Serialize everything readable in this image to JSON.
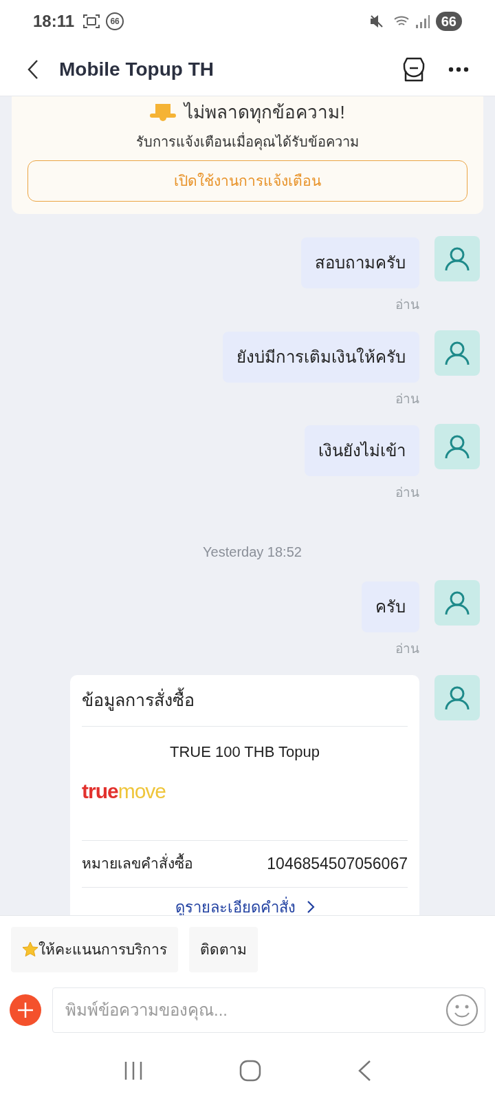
{
  "status_bar": {
    "time": "18:11",
    "notification_count": "66",
    "battery": "66"
  },
  "header": {
    "title": "Mobile Topup TH"
  },
  "banner": {
    "title": "ไม่พลาดทุกข้อความ!",
    "subtitle": "รับการแจ้งเตือนเมื่อคุณได้รับข้อความ",
    "button": "เปิดใช้งานการแจ้งเตือน"
  },
  "messages": [
    {
      "kind": "text",
      "text": "สอบถามครับ",
      "status": "อ่าน"
    },
    {
      "kind": "text",
      "text": "ยังบ่มีการเติมเงินให้ครับ",
      "status": "อ่าน"
    },
    {
      "kind": "text",
      "text": "เงินยังไม่เข้า",
      "status": "อ่าน"
    },
    {
      "kind": "timestamp",
      "text": "Yesterday 18:52"
    },
    {
      "kind": "text",
      "text": "ครับ",
      "status": "อ่าน"
    },
    {
      "kind": "order",
      "title": "ข้อมูลการสั่งซื้อ",
      "product": "TRUE 100 THB Topup",
      "logo": [
        "true",
        "move"
      ],
      "order_label": "หมายเลขคำสั่งซื้อ",
      "order_number": "1046854507056067",
      "link": "ดูรายละเอียดคำสั่ง"
    }
  ],
  "quick_replies": [
    {
      "label": "ให้คะแนนการบริการ",
      "starred": true
    },
    {
      "label": "ติดตาม",
      "starred": false
    }
  ],
  "composer": {
    "placeholder": "พิมพ์ข้อความของคุณ..."
  }
}
